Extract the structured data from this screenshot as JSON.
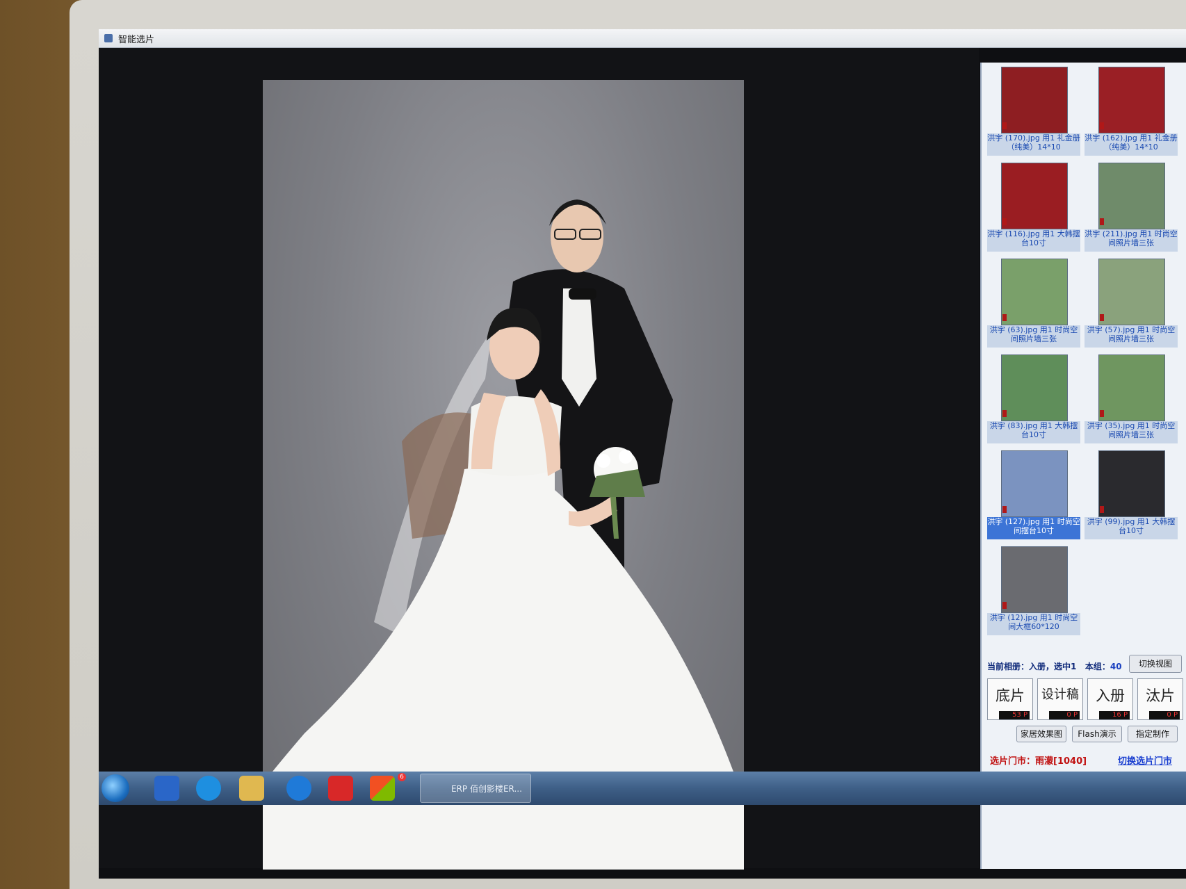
{
  "window": {
    "title": "智能选片"
  },
  "thumbnails": [
    {
      "caption": "洪宇 (170).jpg 用1 礼金册（纯美）14*10",
      "bg": "#8e1e22",
      "selected": false
    },
    {
      "caption": "洪宇 (162).jpg 用1 礼金册（纯美）14*10",
      "bg": "#9a1f25",
      "selected": false
    },
    {
      "caption": "洪宇 (116).jpg 用1 大韩摆台10寸",
      "bg": "#9a1d22",
      "selected": false
    },
    {
      "caption": "洪宇 (211).jpg 用1 时尚空间照片墙三张",
      "bg": "#6f8b6a",
      "selected": false
    },
    {
      "caption": "洪宇 (63).jpg 用1 时尚空间照片墙三张",
      "bg": "#7aa06a",
      "selected": false
    },
    {
      "caption": "洪宇 (57).jpg 用1 时尚空间照片墙三张",
      "bg": "#8aa27c",
      "selected": false
    },
    {
      "caption": "洪宇 (83).jpg 用1 大韩摆台10寸",
      "bg": "#5f8e5a",
      "selected": false
    },
    {
      "caption": "洪宇 (35).jpg 用1 时尚空间照片墙三张",
      "bg": "#6f9660",
      "selected": false
    },
    {
      "caption": "洪宇 (127).jpg 用1 时尚空间摆台10寸",
      "bg": "#7b93c0",
      "selected": true
    },
    {
      "caption": "洪宇 (99).jpg 用1 大韩摆台10寸",
      "bg": "#2a2a2e",
      "selected": false
    },
    {
      "caption": "洪宇 (12).jpg 用1 时尚空间大框60*120",
      "bg": "#6a6b70",
      "selected": false
    }
  ],
  "info": {
    "current_album_label": "当前相册：入册，选中1",
    "group_label": "本组：",
    "group_count": "40",
    "switch_view": "切换视图"
  },
  "categories": [
    {
      "label": "底片",
      "count": "53 P"
    },
    {
      "label": "设计稿",
      "count": "0 P"
    },
    {
      "label": "入册",
      "count": "16 P"
    },
    {
      "label": "汰片",
      "count": "0 P"
    }
  ],
  "actions": {
    "home_effect": "家居效果图",
    "flash_demo": "Flash演示",
    "assign_make": "指定制作"
  },
  "store": {
    "label": "选片门市：雨濛[1040]",
    "switch_label": "切换选片门市"
  },
  "taskbar": {
    "task_label": "ERP 佰创影楼ER...",
    "badge": "6"
  }
}
